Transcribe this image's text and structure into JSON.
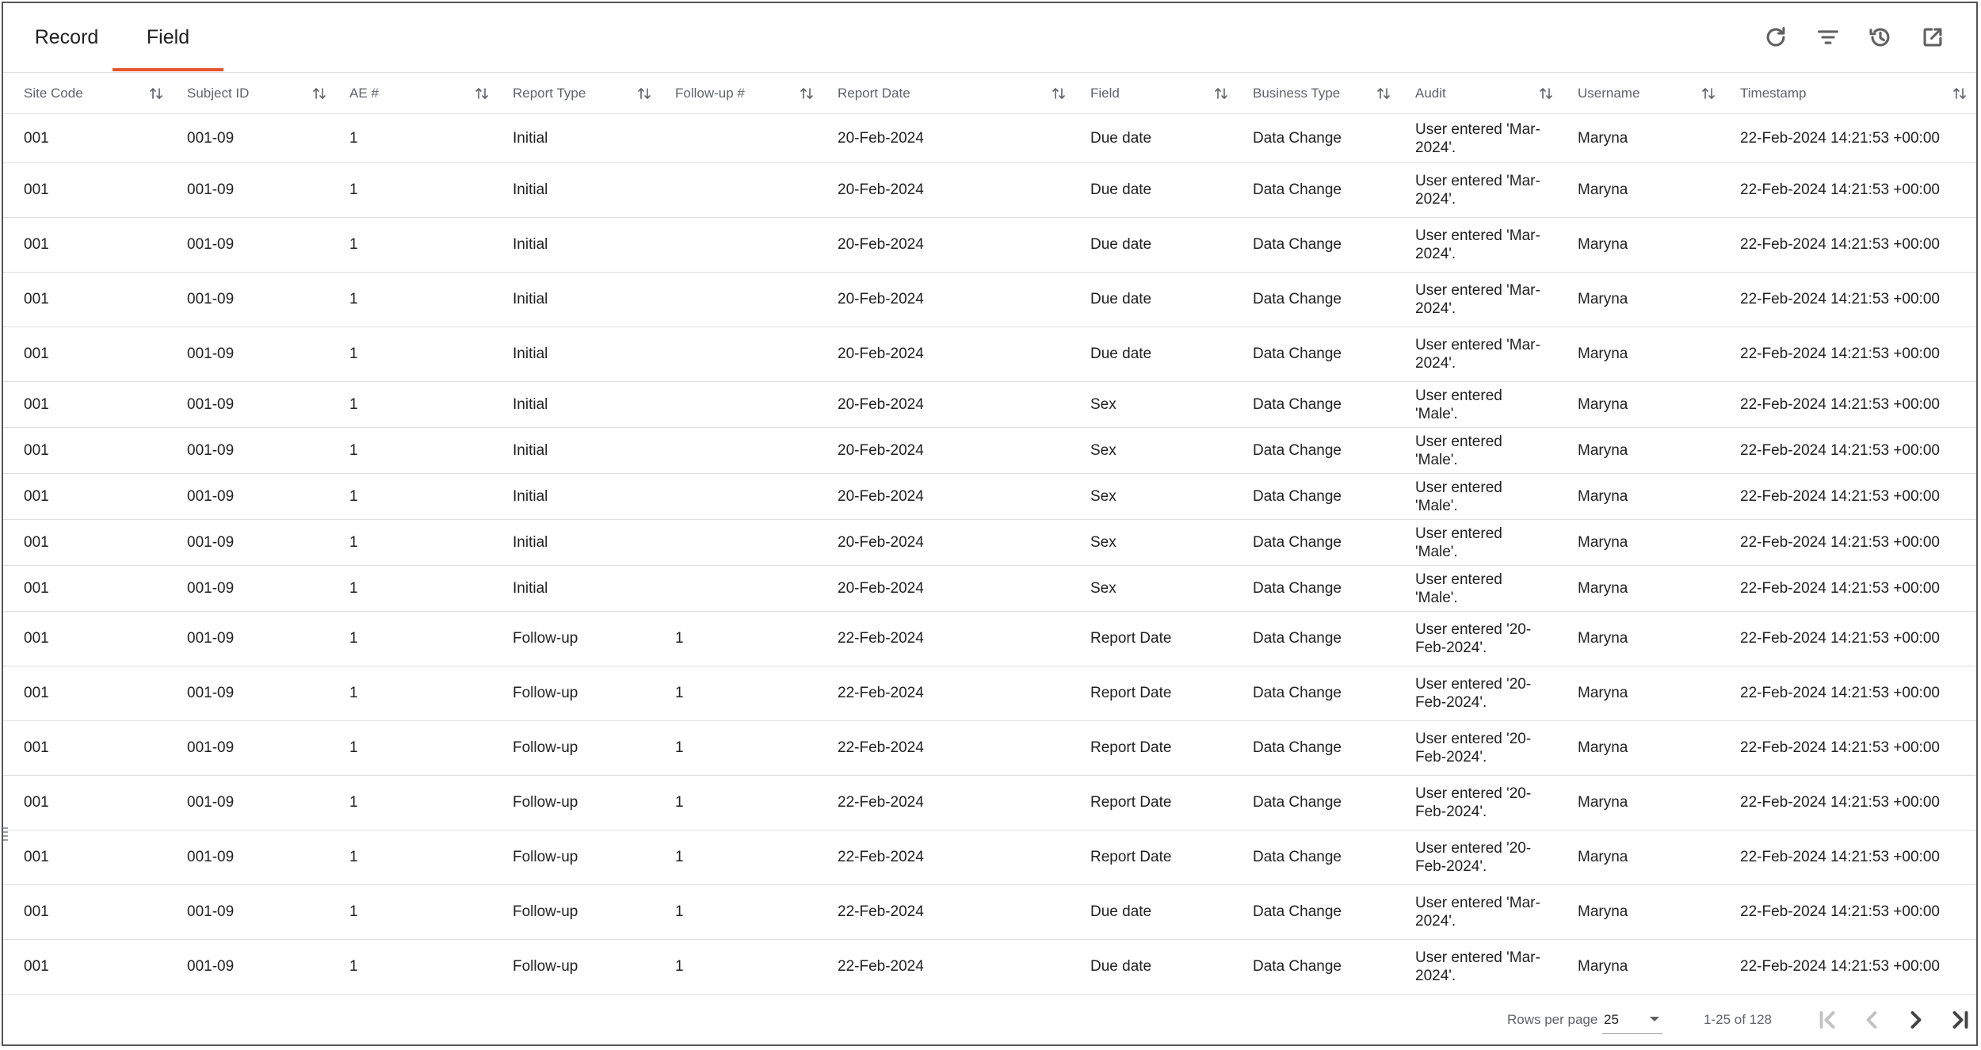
{
  "tabs": [
    {
      "label": "Record"
    },
    {
      "label": "Field"
    }
  ],
  "active_tab": "Field",
  "colors": {
    "accent": "#e8552d",
    "header_text": "#5f6368",
    "divider": "#e0e0e0"
  },
  "toolbar": {
    "icons": [
      "refresh-icon",
      "filter-icon",
      "history-icon",
      "open-in-new-icon"
    ]
  },
  "table": {
    "columns": [
      "Site Code",
      "Subject ID",
      "AE #",
      "Report Type",
      "Follow-up #",
      "Report Date",
      "Field",
      "Business Type",
      "Audit",
      "Username",
      "Timestamp"
    ],
    "rows": [
      [
        "001",
        "001-09",
        "1",
        "Initial",
        "",
        "20-Feb-2024",
        "Due date",
        "Data Change",
        "User entered 'Mar-2024'.",
        "Maryna",
        "22-Feb-2024 14:21:53 +00:00"
      ],
      [
        "001",
        "001-09",
        "1",
        "Initial",
        "",
        "20-Feb-2024",
        "Due date",
        "Data Change",
        "User entered 'Mar-2024'.",
        "Maryna",
        "22-Feb-2024 14:21:53 +00:00"
      ],
      [
        "001",
        "001-09",
        "1",
        "Initial",
        "",
        "20-Feb-2024",
        "Due date",
        "Data Change",
        "User entered 'Mar-2024'.",
        "Maryna",
        "22-Feb-2024 14:21:53 +00:00"
      ],
      [
        "001",
        "001-09",
        "1",
        "Initial",
        "",
        "20-Feb-2024",
        "Due date",
        "Data Change",
        "User entered 'Mar-2024'.",
        "Maryna",
        "22-Feb-2024 14:21:53 +00:00"
      ],
      [
        "001",
        "001-09",
        "1",
        "Initial",
        "",
        "20-Feb-2024",
        "Due date",
        "Data Change",
        "User entered 'Mar-2024'.",
        "Maryna",
        "22-Feb-2024 14:21:53 +00:00"
      ],
      [
        "001",
        "001-09",
        "1",
        "Initial",
        "",
        "20-Feb-2024",
        "Sex",
        "Data Change",
        "User entered 'Male'.",
        "Maryna",
        "22-Feb-2024 14:21:53 +00:00"
      ],
      [
        "001",
        "001-09",
        "1",
        "Initial",
        "",
        "20-Feb-2024",
        "Sex",
        "Data Change",
        "User entered 'Male'.",
        "Maryna",
        "22-Feb-2024 14:21:53 +00:00"
      ],
      [
        "001",
        "001-09",
        "1",
        "Initial",
        "",
        "20-Feb-2024",
        "Sex",
        "Data Change",
        "User entered 'Male'.",
        "Maryna",
        "22-Feb-2024 14:21:53 +00:00"
      ],
      [
        "001",
        "001-09",
        "1",
        "Initial",
        "",
        "20-Feb-2024",
        "Sex",
        "Data Change",
        "User entered 'Male'.",
        "Maryna",
        "22-Feb-2024 14:21:53 +00:00"
      ],
      [
        "001",
        "001-09",
        "1",
        "Initial",
        "",
        "20-Feb-2024",
        "Sex",
        "Data Change",
        "User entered 'Male'.",
        "Maryna",
        "22-Feb-2024 14:21:53 +00:00"
      ],
      [
        "001",
        "001-09",
        "1",
        "Follow-up",
        "1",
        "22-Feb-2024",
        "Report Date",
        "Data Change",
        "User entered '20-Feb-2024'.",
        "Maryna",
        "22-Feb-2024 14:21:53 +00:00"
      ],
      [
        "001",
        "001-09",
        "1",
        "Follow-up",
        "1",
        "22-Feb-2024",
        "Report Date",
        "Data Change",
        "User entered '20-Feb-2024'.",
        "Maryna",
        "22-Feb-2024 14:21:53 +00:00"
      ],
      [
        "001",
        "001-09",
        "1",
        "Follow-up",
        "1",
        "22-Feb-2024",
        "Report Date",
        "Data Change",
        "User entered '20-Feb-2024'.",
        "Maryna",
        "22-Feb-2024 14:21:53 +00:00"
      ],
      [
        "001",
        "001-09",
        "1",
        "Follow-up",
        "1",
        "22-Feb-2024",
        "Report Date",
        "Data Change",
        "User entered '20-Feb-2024'.",
        "Maryna",
        "22-Feb-2024 14:21:53 +00:00"
      ],
      [
        "001",
        "001-09",
        "1",
        "Follow-up",
        "1",
        "22-Feb-2024",
        "Report Date",
        "Data Change",
        "User entered '20-Feb-2024'.",
        "Maryna",
        "22-Feb-2024 14:21:53 +00:00"
      ],
      [
        "001",
        "001-09",
        "1",
        "Follow-up",
        "1",
        "22-Feb-2024",
        "Due date",
        "Data Change",
        "User entered 'Mar-2024'.",
        "Maryna",
        "22-Feb-2024 14:21:53 +00:00"
      ],
      [
        "001",
        "001-09",
        "1",
        "Follow-up",
        "1",
        "22-Feb-2024",
        "Due date",
        "Data Change",
        "User entered 'Mar-2024'.",
        "Maryna",
        "22-Feb-2024 14:21:53 +00:00"
      ]
    ]
  },
  "pagination": {
    "rows_per_page_label": "Rows per page",
    "rows_per_page_value": "25",
    "range_text": "1-25 of 128"
  }
}
